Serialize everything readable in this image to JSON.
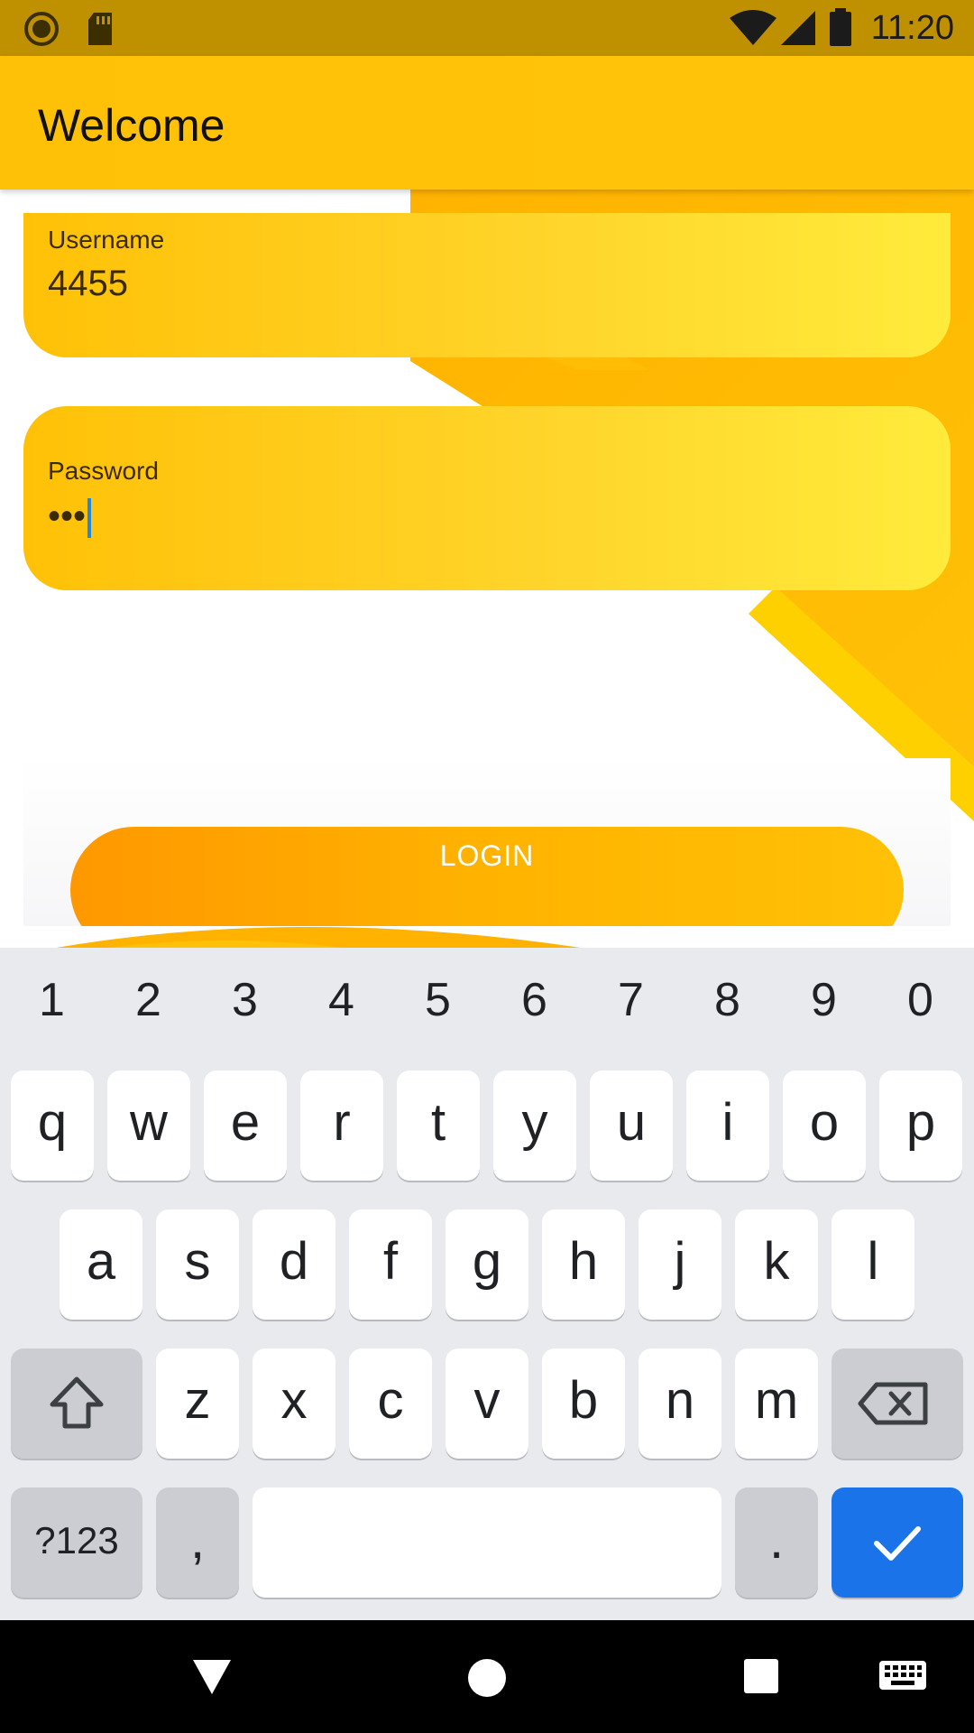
{
  "status_bar": {
    "time": "11:20",
    "icons": [
      "record-icon",
      "sd-card-icon",
      "wifi-icon",
      "cell-signal-icon",
      "battery-icon"
    ]
  },
  "app_bar": {
    "title": "Welcome"
  },
  "form": {
    "username": {
      "label": "Username",
      "value": "4455"
    },
    "password": {
      "label": "Password",
      "value": "•••"
    },
    "login_label": "LOGIN"
  },
  "keyboard": {
    "numbers": [
      "1",
      "2",
      "3",
      "4",
      "5",
      "6",
      "7",
      "8",
      "9",
      "0"
    ],
    "row1": [
      "q",
      "w",
      "e",
      "r",
      "t",
      "y",
      "u",
      "i",
      "o",
      "p"
    ],
    "row2": [
      "a",
      "s",
      "d",
      "f",
      "g",
      "h",
      "j",
      "k",
      "l"
    ],
    "row3": [
      "z",
      "x",
      "c",
      "v",
      "b",
      "n",
      "m"
    ],
    "symbols_label": "?123",
    "comma": ",",
    "period": "."
  },
  "colors": {
    "accent": "#FFC107",
    "status_bar": "#BF9000",
    "button": "#FF9800",
    "enter_key": "#1A73E8"
  }
}
